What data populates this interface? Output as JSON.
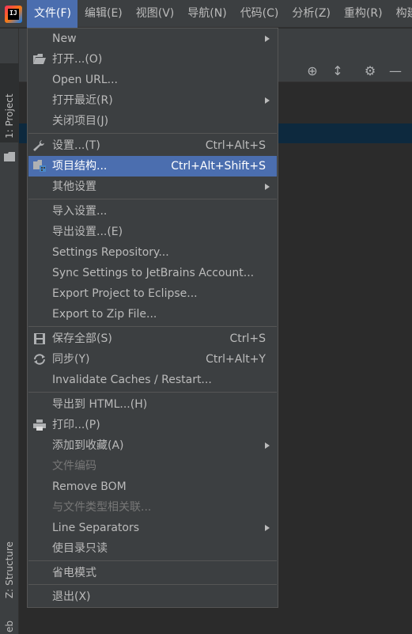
{
  "menubar": {
    "items": [
      "文件(F)",
      "编辑(E)",
      "视图(V)",
      "导航(N)",
      "代码(C)",
      "分析(Z)",
      "重构(R)",
      "构建"
    ]
  },
  "left_strip": {
    "project_tab": "1: Project",
    "structure_tab": "Z: Structure",
    "web_tab": "eb"
  },
  "file_menu": {
    "items": [
      {
        "label": "New",
        "shortcut": "",
        "submenu": true,
        "icon": "",
        "disabled": false,
        "selected": false
      },
      {
        "label": "打开...(O)",
        "shortcut": "",
        "submenu": false,
        "icon": "folder-open-icon",
        "disabled": false,
        "selected": false
      },
      {
        "label": "Open URL...",
        "shortcut": "",
        "submenu": false,
        "icon": "",
        "disabled": false,
        "selected": false
      },
      {
        "label": "打开最近(R)",
        "shortcut": "",
        "submenu": true,
        "icon": "",
        "disabled": false,
        "selected": false
      },
      {
        "label": "关闭项目(J)",
        "shortcut": "",
        "submenu": false,
        "icon": "",
        "disabled": false,
        "selected": false
      },
      {
        "label": "设置...(T)",
        "shortcut": "Ctrl+Alt+S",
        "submenu": false,
        "icon": "wrench-icon",
        "disabled": false,
        "selected": false
      },
      {
        "label": "项目结构...",
        "shortcut": "Ctrl+Alt+Shift+S",
        "submenu": false,
        "icon": "project-structure-icon",
        "disabled": false,
        "selected": true
      },
      {
        "label": "其他设置",
        "shortcut": "",
        "submenu": true,
        "icon": "",
        "disabled": false,
        "selected": false
      },
      {
        "label": "导入设置...",
        "shortcut": "",
        "submenu": false,
        "icon": "",
        "disabled": false,
        "selected": false
      },
      {
        "label": "导出设置...(E)",
        "shortcut": "",
        "submenu": false,
        "icon": "",
        "disabled": false,
        "selected": false
      },
      {
        "label": "Settings Repository...",
        "shortcut": "",
        "submenu": false,
        "icon": "",
        "disabled": false,
        "selected": false
      },
      {
        "label": "Sync Settings to JetBrains Account...",
        "shortcut": "",
        "submenu": false,
        "icon": "",
        "disabled": false,
        "selected": false
      },
      {
        "label": "Export Project to Eclipse...",
        "shortcut": "",
        "submenu": false,
        "icon": "",
        "disabled": false,
        "selected": false
      },
      {
        "label": "Export to Zip File...",
        "shortcut": "",
        "submenu": false,
        "icon": "",
        "disabled": false,
        "selected": false
      },
      {
        "label": "保存全部(S)",
        "shortcut": "Ctrl+S",
        "submenu": false,
        "icon": "save-icon",
        "disabled": false,
        "selected": false
      },
      {
        "label": "同步(Y)",
        "shortcut": "Ctrl+Alt+Y",
        "submenu": false,
        "icon": "sync-icon",
        "disabled": false,
        "selected": false
      },
      {
        "label": "Invalidate Caches / Restart...",
        "shortcut": "",
        "submenu": false,
        "icon": "",
        "disabled": false,
        "selected": false
      },
      {
        "label": "导出到 HTML...(H)",
        "shortcut": "",
        "submenu": false,
        "icon": "",
        "disabled": false,
        "selected": false
      },
      {
        "label": "打印...(P)",
        "shortcut": "",
        "submenu": false,
        "icon": "printer-icon",
        "disabled": false,
        "selected": false
      },
      {
        "label": "添加到收藏(A)",
        "shortcut": "",
        "submenu": true,
        "icon": "",
        "disabled": false,
        "selected": false
      },
      {
        "label": "文件编码",
        "shortcut": "",
        "submenu": false,
        "icon": "",
        "disabled": true,
        "selected": false
      },
      {
        "label": "Remove BOM",
        "shortcut": "",
        "submenu": false,
        "icon": "",
        "disabled": false,
        "selected": false
      },
      {
        "label": "与文件类型相关联...",
        "shortcut": "",
        "submenu": false,
        "icon": "",
        "disabled": true,
        "selected": false
      },
      {
        "label": "Line Separators",
        "shortcut": "",
        "submenu": true,
        "icon": "",
        "disabled": false,
        "selected": false
      },
      {
        "label": "使目录只读",
        "shortcut": "",
        "submenu": false,
        "icon": "",
        "disabled": false,
        "selected": false
      },
      {
        "label": "省电模式",
        "shortcut": "",
        "submenu": false,
        "icon": "",
        "disabled": false,
        "selected": false
      },
      {
        "label": "退出(X)",
        "shortcut": "",
        "submenu": false,
        "icon": "",
        "disabled": false,
        "selected": false
      }
    ]
  },
  "colors": {
    "menu_bg": "#3c3f41",
    "selection": "#4b6eaf",
    "text": "#bbbbbb",
    "disabled_text": "#777777"
  }
}
